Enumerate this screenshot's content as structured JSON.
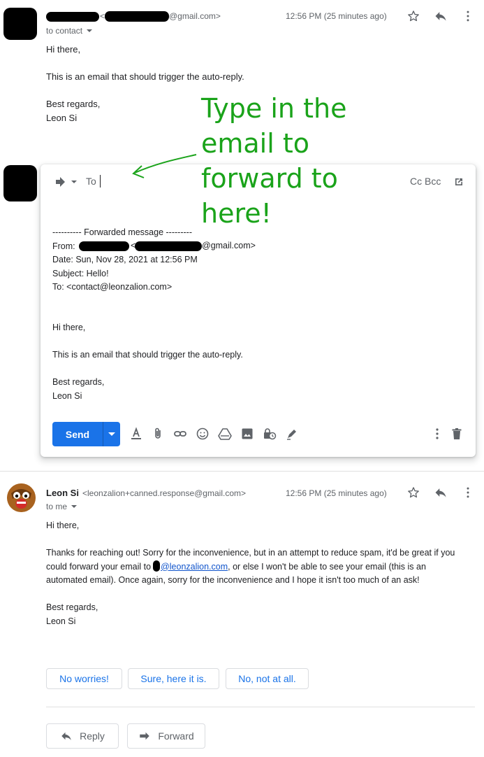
{
  "message1": {
    "sender_email_suffix": "@gmail.com>",
    "sender_email_prefix": "<",
    "timestamp": "12:56 PM (25 minutes ago)",
    "recipient": "to contact",
    "body": {
      "greeting": "Hi there,",
      "line1": "This is an email that should trigger the auto-reply.",
      "signoff": "Best regards,",
      "name": "Leon Si"
    }
  },
  "annotation": {
    "text": "Type in the email to forward to here!"
  },
  "compose": {
    "to_label": "To",
    "cc_bcc_label": "Cc Bcc",
    "forwarded": {
      "header": "---------- Forwarded message ---------",
      "from_label": "From:",
      "from_suffix": "@gmail.com>",
      "from_prefix": "<",
      "date": "Date: Sun, Nov 28, 2021 at 12:56 PM",
      "subject": "Subject: Hello!",
      "to": "To: <contact@leonzalion.com>"
    },
    "body": {
      "greeting": "Hi there,",
      "line1": "This is an email that should trigger the auto-reply.",
      "signoff": "Best regards,",
      "name": "Leon Si"
    },
    "send_label": "Send"
  },
  "message2": {
    "sender_name": "Leon Si",
    "sender_email": "<leonzalion+canned.response@gmail.com>",
    "timestamp": "12:56 PM (25 minutes ago)",
    "recipient": "to me",
    "body": {
      "greeting": "Hi there,",
      "para_a": "Thanks for reaching out! Sorry for the inconvenience, but in an attempt to reduce spam, it'd be great if you",
      "para_b_pre": "could forward your email to",
      "para_b_link": "@leonzalion.com",
      "para_b_post": ", or else I won't be able to see your email (this is an",
      "para_c": "automated email). Once again, sorry for the inconvenience and I hope it isn't too much of an ask!",
      "signoff": "Best regards,",
      "name": "Leon Si"
    }
  },
  "smart_replies": [
    "No worries!",
    "Sure, here it is.",
    "No, not at all."
  ],
  "actions": {
    "reply_label": "Reply",
    "forward_label": "Forward"
  },
  "colors": {
    "accent": "#1a73e8",
    "annotation": "#1aa31a"
  }
}
